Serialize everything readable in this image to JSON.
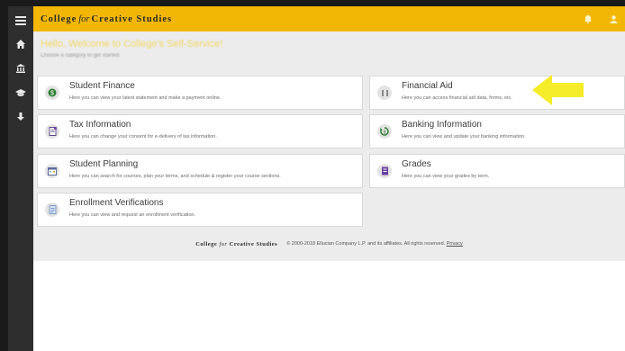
{
  "header": {
    "logo_part1": "College",
    "logo_italic": "for",
    "logo_part2": "Creative Studies"
  },
  "welcome": {
    "title": "Hello, Welcome to College's Self-Service!",
    "subtitle": "Choose a category to get started."
  },
  "cards": [
    {
      "title": "Student Finance",
      "desc": "Here you can view your latest statement and make a payment online.",
      "icon": "dollar-icon",
      "color": "#2e7d32"
    },
    {
      "title": "Financial Aid",
      "desc": "Here you can access financial aid data, forms, etc.",
      "icon": "columns-icon",
      "color": "#8a8a8a"
    },
    {
      "title": "Tax Information",
      "desc": "Here you can change your consent for e-delivery of tax information.",
      "icon": "tax-form-icon",
      "color": "#5b4a8a"
    },
    {
      "title": "Banking Information",
      "desc": "Here you can view and update your banking information.",
      "icon": "bank-cycle-icon",
      "color": "#2e7d32"
    },
    {
      "title": "Student Planning",
      "desc": "Here you can search for courses, plan your terms, and schedule & register your course sections.",
      "icon": "calendar-icon",
      "color": "#5b6a9a"
    },
    {
      "title": "Grades",
      "desc": "Here you can view your grades by term.",
      "icon": "grades-book-icon",
      "color": "#6a3fa0"
    },
    {
      "title": "Enrollment Verifications",
      "desc": "Here you can view and request an enrollment verification.",
      "icon": "verification-icon",
      "color": "#6a86b8"
    }
  ],
  "footer": {
    "logo_part1": "College",
    "logo_italic": "for",
    "logo_part2": "Creative Studies",
    "copyright": "© 2000-2018 Ellucian Company L.P. and its affiliates. All rights reserved.",
    "privacy": "Privacy"
  },
  "colors": {
    "accent": "#f2b705",
    "sidebar": "#2e2e2e",
    "arrow": "#f5ec2a"
  }
}
